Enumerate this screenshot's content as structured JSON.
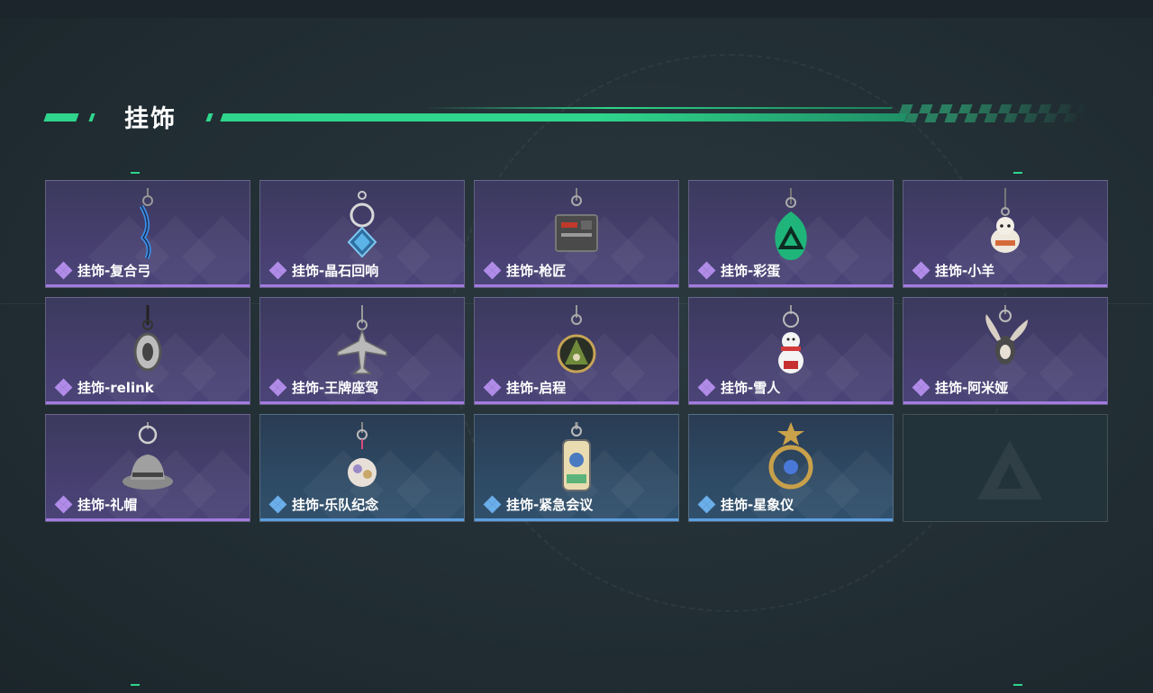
{
  "header": {
    "title": "挂饰"
  },
  "items": [
    {
      "label": "挂饰-复合弓",
      "rarity": "purple",
      "icon": "bow-charm-icon"
    },
    {
      "label": "挂饰-晶石回响",
      "rarity": "purple",
      "icon": "crystal-charm-icon"
    },
    {
      "label": "挂饰-枪匠",
      "rarity": "purple",
      "icon": "gunsmith-charm-icon"
    },
    {
      "label": "挂饰-彩蛋",
      "rarity": "purple",
      "icon": "easter-egg-charm-icon"
    },
    {
      "label": "挂饰-小羊",
      "rarity": "purple",
      "icon": "lamb-charm-icon"
    },
    {
      "label": "挂饰-relink",
      "rarity": "purple",
      "icon": "relink-charm-icon"
    },
    {
      "label": "挂饰-王牌座驾",
      "rarity": "purple",
      "icon": "jet-charm-icon"
    },
    {
      "label": "挂饰-启程",
      "rarity": "purple",
      "icon": "departure-charm-icon"
    },
    {
      "label": "挂饰-雪人",
      "rarity": "purple",
      "icon": "snowman-charm-icon"
    },
    {
      "label": "挂饰-阿米娅",
      "rarity": "purple",
      "icon": "amiya-charm-icon"
    },
    {
      "label": "挂饰-礼帽",
      "rarity": "purple",
      "icon": "top-hat-charm-icon"
    },
    {
      "label": "挂饰-乐队纪念",
      "rarity": "blue",
      "icon": "band-charm-icon"
    },
    {
      "label": "挂饰-紧急会议",
      "rarity": "blue",
      "icon": "emergency-meeting-charm-icon"
    },
    {
      "label": "挂饰-星象仪",
      "rarity": "blue",
      "icon": "astrolabe-charm-icon"
    }
  ],
  "colors": {
    "accent": "#2fd58c",
    "rarity_purple": "#a37be0",
    "rarity_blue": "#5b9fe0"
  }
}
